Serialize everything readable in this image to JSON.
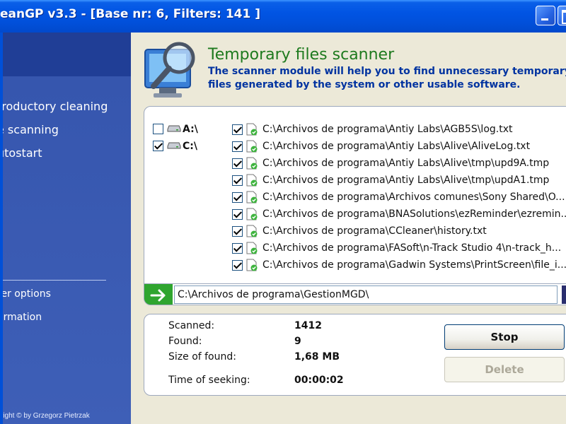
{
  "window": {
    "title": "eanGP  v3.3 - [Base nr: 6, Filters: 141 ]"
  },
  "sidebar": {
    "items": [
      {
        "label": "troductory cleaning"
      },
      {
        "label": "e scanning"
      },
      {
        "label": "utostart"
      }
    ],
    "bottom_items": [
      {
        "label": "ter options"
      },
      {
        "label": "ormation"
      }
    ],
    "copyright": "yright © by Grzegorz Pietrzak"
  },
  "header": {
    "title": "Temporary files scanner",
    "description": "The scanner module will help you to find unnecessary temporary files generated by the system or other usable software.",
    "icon": "magnifier-monitor-icon"
  },
  "drives": [
    {
      "label": "A:\\",
      "checked": false
    },
    {
      "label": "C:\\",
      "checked": true
    }
  ],
  "files": [
    {
      "path": "C:\\Archivos de programa\\Antiy Labs\\AGB5S\\log.txt",
      "checked": true
    },
    {
      "path": "C:\\Archivos de programa\\Antiy Labs\\Alive\\AliveLog.txt",
      "checked": true
    },
    {
      "path": "C:\\Archivos de programa\\Antiy Labs\\Alive\\tmp\\upd9A.tmp",
      "checked": true
    },
    {
      "path": "C:\\Archivos de programa\\Antiy Labs\\Alive\\tmp\\updA1.tmp",
      "checked": true
    },
    {
      "path": "C:\\Archivos de programa\\Archivos comunes\\Sony Shared\\O...",
      "checked": true
    },
    {
      "path": "C:\\Archivos de programa\\BNASolutions\\ezReminder\\ezremin...",
      "checked": true
    },
    {
      "path": "C:\\Archivos de programa\\CCleaner\\history.txt",
      "checked": true
    },
    {
      "path": "C:\\Archivos de programa\\FASoft\\n-Track Studio 4\\n-track_h...",
      "checked": true
    },
    {
      "path": "C:\\Archivos de programa\\Gadwin Systems\\PrintScreen\\file_i...",
      "checked": true
    }
  ],
  "current": {
    "path": "C:\\Archivos de programa\\GestionMGD\\"
  },
  "stats": {
    "scanned_label": "Scanned:",
    "scanned_value": "1412",
    "found_label": "Found:",
    "found_value": "9",
    "size_label": "Size of found:",
    "size_value": "1,68 MB",
    "time_label": "Time of seeking:",
    "time_value": "00:00:02"
  },
  "buttons": {
    "stop": "Stop",
    "delete": "Delete"
  },
  "colors": {
    "titlebar": "#0154E3",
    "sidebar": "#3656AE",
    "header_title": "#1E7A1E",
    "header_desc": "#0033A0"
  }
}
